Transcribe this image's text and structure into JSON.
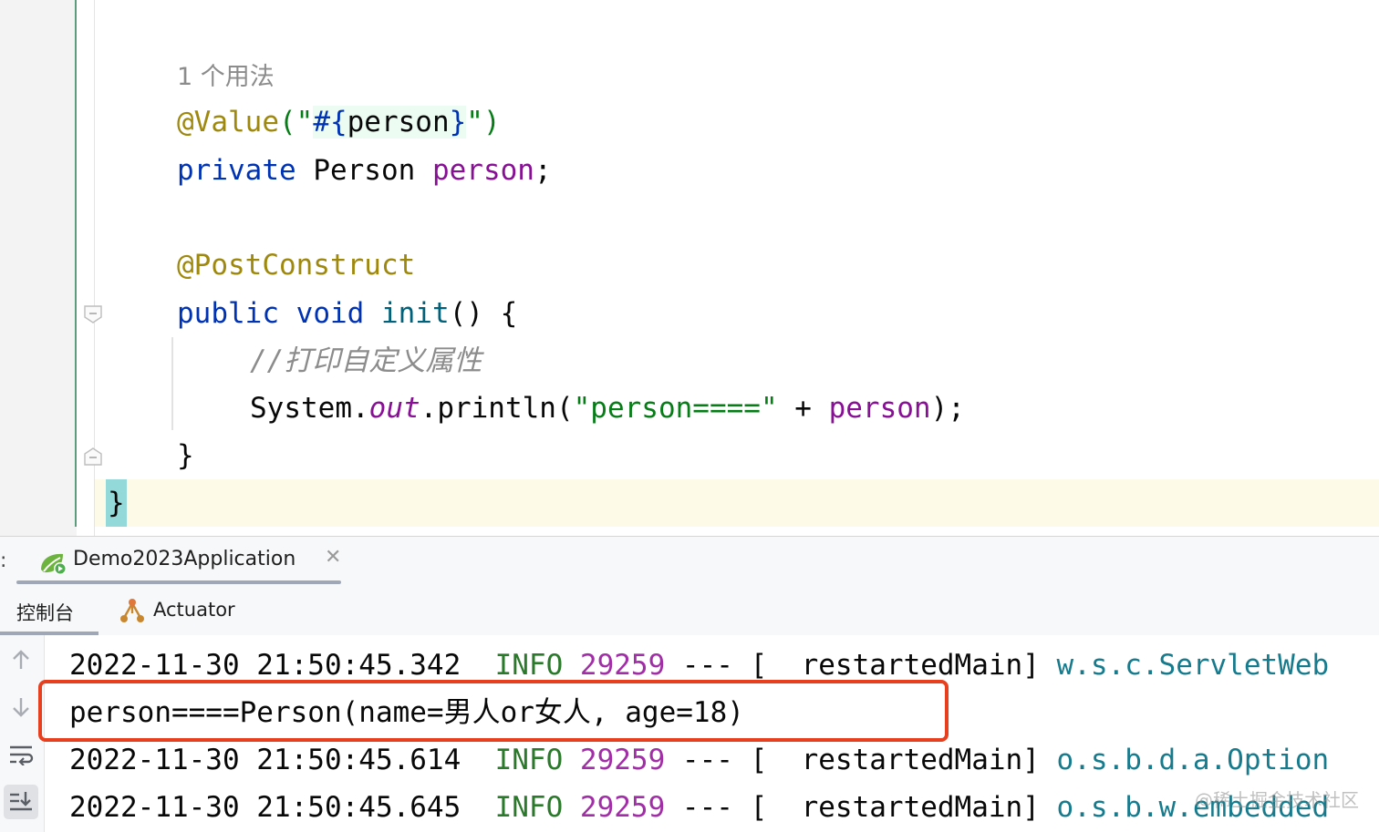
{
  "editor": {
    "usage_hint": "1 个用法",
    "line1": {
      "ann": "@Value",
      "open": "(\"",
      "spel_hash": "#{",
      "spel_ident": "person",
      "spel_close": "}",
      "close": "\")"
    },
    "line2": {
      "kw": "private",
      "type": " Person ",
      "field": "person",
      "end": ";"
    },
    "line3": {
      "ann": "@PostConstruct"
    },
    "line4": {
      "kw1": "public",
      "kw2": "void",
      "method": "init",
      "rest": "() {"
    },
    "line5": {
      "comment": "//打印自定义属性"
    },
    "line6": {
      "cls": "System.",
      "static_field": "out",
      "call": ".println(",
      "str": "\"person====\"",
      "plus": " + ",
      "field": "person",
      "end": ");"
    },
    "line7": {
      "text": "}"
    },
    "line8": {
      "text": "}"
    }
  },
  "run_panel": {
    "tab_title": "Demo2023Application",
    "close_glyph": "✕",
    "left_dots": ":",
    "subtabs": {
      "console": "控制台",
      "actuator": "Actuator"
    }
  },
  "console": {
    "lines": [
      {
        "time": "2022-11-30 21:50:45.342",
        "level": "INFO",
        "pid": "29259",
        "sep": "---",
        "thread": "[  restartedMain]",
        "logger": "w.s.c.ServletWeb"
      },
      {
        "text": "person====Person(name=男人or女人, age=18)"
      },
      {
        "time": "2022-11-30 21:50:45.614",
        "level": "INFO",
        "pid": "29259",
        "sep": "---",
        "thread": "[  restartedMain]",
        "logger": "o.s.b.d.a.Option"
      },
      {
        "time": "2022-11-30 21:50:45.645",
        "level": "INFO",
        "pid": "29259",
        "sep": "---",
        "thread": "[  restartedMain]",
        "logger": "o.s.b.w.embedded"
      }
    ]
  },
  "watermark": "@稀土掘金技术社区",
  "colors": {
    "highlight": "#e8401f",
    "gutter_accent": "#5c9c7a",
    "caret_line": "#fdfbe8"
  }
}
